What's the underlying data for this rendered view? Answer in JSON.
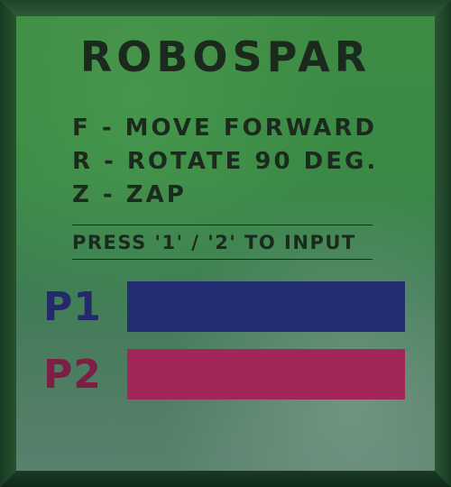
{
  "title": "ROBOSPAR",
  "controls": [
    {
      "text": "F - MOVE FORWARD"
    },
    {
      "text": "R - ROTATE 90 DEG."
    },
    {
      "text": "Z - ZAP"
    }
  ],
  "prompt": "PRESS '1' / '2' TO INPUT",
  "players": {
    "p1": {
      "label": "P1",
      "input": "",
      "color": "#232d72"
    },
    "p2": {
      "label": "P2",
      "input": "",
      "color": "#a32659"
    }
  },
  "colors": {
    "text": "#1b2a1d",
    "background": "#3f8c43",
    "border": "#1f4a2c"
  }
}
